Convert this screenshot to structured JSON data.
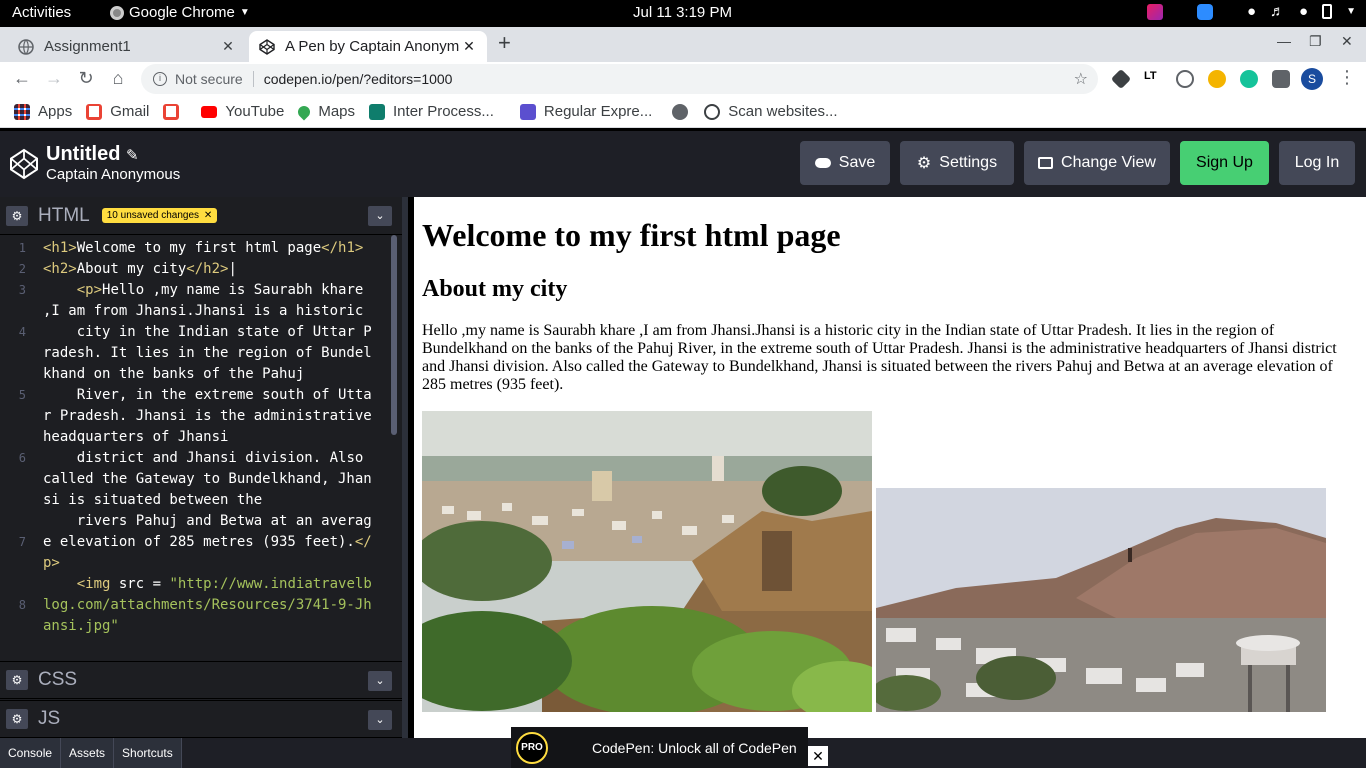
{
  "system_bar": {
    "activities": "Activities",
    "app_name": "Google Chrome",
    "clock": "Jul 11   3:19 PM"
  },
  "browser": {
    "tabs": [
      {
        "title": "Assignment1",
        "active": false
      },
      {
        "title": "A Pen by Captain Anonym",
        "active": true
      }
    ],
    "address": {
      "security_label": "Not secure",
      "url": "codepen.io/pen/?editors=1000"
    },
    "bookmarks": [
      {
        "label": "Apps",
        "icon": "apps-grid-icon"
      },
      {
        "label": "Gmail",
        "icon": "gmail-icon"
      },
      {
        "label": "",
        "icon": "gmail-icon"
      },
      {
        "label": "YouTube",
        "icon": "youtube-icon"
      },
      {
        "label": "Maps",
        "icon": "maps-icon"
      },
      {
        "label": "Inter Process...",
        "icon": "page-icon"
      },
      {
        "label": "Regular Expre...",
        "icon": "page-icon"
      },
      {
        "label": "",
        "icon": "globe-icon"
      },
      {
        "label": "Scan websites...",
        "icon": "scan-icon"
      }
    ],
    "profile_initial": "S"
  },
  "codepen": {
    "title": "Untitled",
    "owner": "Captain Anonymous",
    "buttons": {
      "save": "Save",
      "settings": "Settings",
      "change_view": "Change View",
      "sign_up": "Sign Up",
      "log_in": "Log In"
    },
    "editors": {
      "html_label": "HTML",
      "unsaved_badge": "10 unsaved changes",
      "css_label": "CSS",
      "js_label": "JS"
    },
    "line_numbers": [
      "1",
      "2",
      "3",
      "4",
      "5",
      "6",
      "7",
      "8"
    ],
    "bottom_buttons": [
      "Console",
      "Assets",
      "Shortcuts"
    ],
    "promo": {
      "badge": "PRO",
      "text": "CodePen: Unlock all of CodePen"
    }
  },
  "preview": {
    "h1": "Welcome to my first html page",
    "h2": "About my city",
    "paragraph": "Hello ,my name is Saurabh khare ,I am from Jhansi.Jhansi is a historic city in the Indian state of Uttar Pradesh. It lies in the region of Bundelkhand on the banks of the Pahuj River, in the extreme south of Uttar Pradesh. Jhansi is the administrative headquarters of Jhansi district and Jhansi division. Also called the Gateway to Bundelkhand, Jhansi is situated between the rivers Pahuj and Betwa at an average elevation of 285 metres (935 feet)."
  },
  "colors": {
    "codepen_header": "#1e1f26",
    "signup_green": "#47cf73",
    "badge_yellow": "#ffdd40",
    "tag_color": "#ddca7e",
    "string_color": "#a5c25c"
  }
}
